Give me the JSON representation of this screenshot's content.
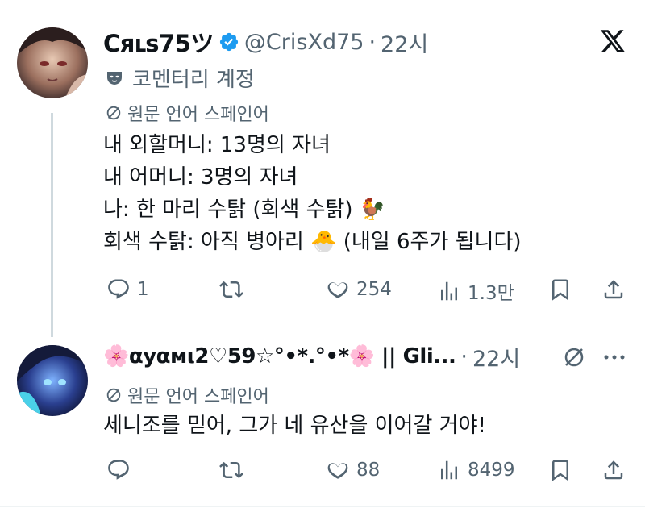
{
  "tweet1": {
    "display_name": "Cяւs75ツ",
    "handle": "@CrisXd75",
    "separator": "·",
    "time": "22시",
    "account_label": "코멘터리 계정",
    "translated_from": "원문 언어 스페인어",
    "lines": [
      "내 외할머니: 13명의 자녀",
      "내 어머니: 3명의 자녀",
      "나: 한 마리 수탉 (회색 수탉) 🐓",
      "회색 수탉: 아직 병아리 🐣 (내일 6주가 됩니다)"
    ],
    "replies": "1",
    "retweets": "",
    "likes": "254",
    "views": "1.3만"
  },
  "tweet2": {
    "display_name": "🌸αуαмι2♡59☆°•*.°•*🌸 || Gli...",
    "separator": "·",
    "time": "22시",
    "translated_from": "원문 언어 스페인어",
    "text": "세니조를 믿어, 그가 네 유산을 이어갈 거야!",
    "replies": "",
    "retweets": "",
    "likes": "88",
    "views": "8499"
  },
  "colors": {
    "verified": "#1d9bf0",
    "muted": "#536471",
    "text": "#0f1419",
    "thread_line": "#cfd9de"
  },
  "icons": [
    "x-logo-icon",
    "verified-badge-icon",
    "mask-icon",
    "translate-icon",
    "reply-icon",
    "retweet-icon",
    "like-icon",
    "views-icon",
    "bookmark-icon",
    "share-icon",
    "grok-icon",
    "more-icon"
  ]
}
